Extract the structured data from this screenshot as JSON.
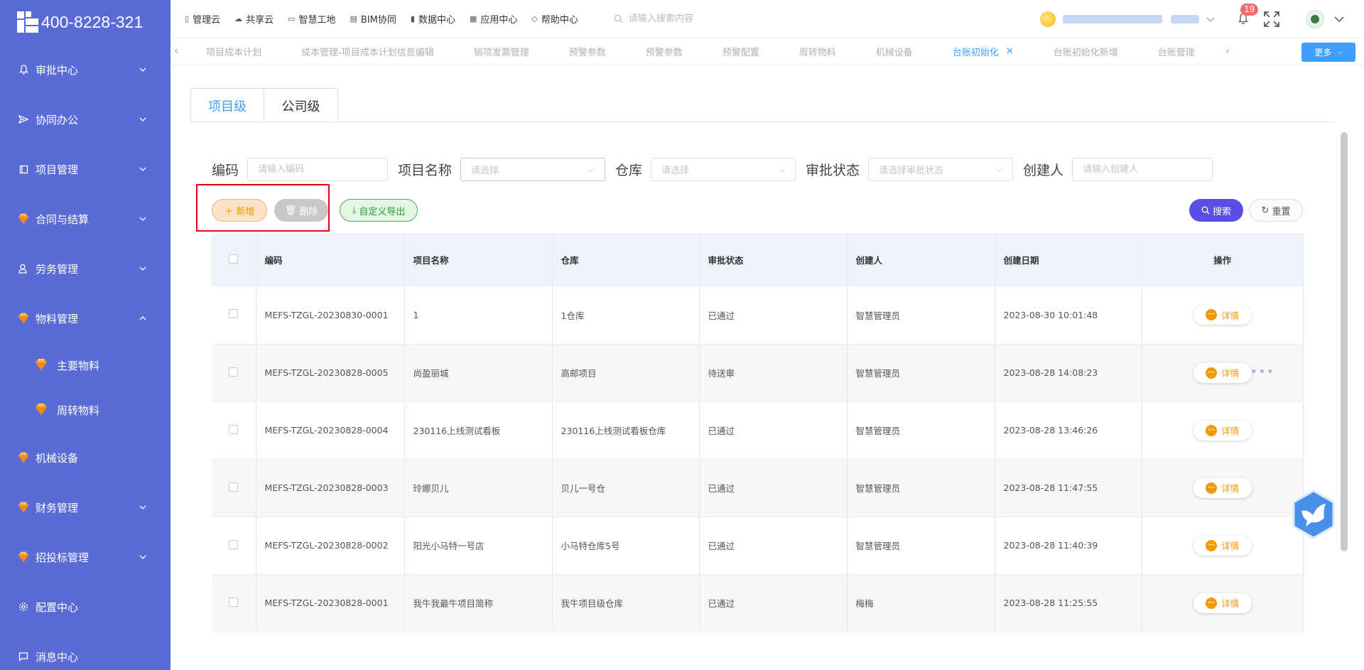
{
  "app": {
    "phone": "400-8228-321"
  },
  "sidebar": {
    "items": [
      {
        "label": "审批中心",
        "icon": "bell-icon"
      },
      {
        "label": "协同办公",
        "icon": "send-icon"
      },
      {
        "label": "项目管理",
        "icon": "book-icon"
      },
      {
        "label": "合同与结算",
        "icon": "gem-icon"
      },
      {
        "label": "劳务管理",
        "icon": "user-icon"
      },
      {
        "label": "物料管理",
        "icon": "gem-icon"
      },
      {
        "label": "机械设备",
        "icon": "gem-icon"
      },
      {
        "label": "财务管理",
        "icon": "gem-icon"
      },
      {
        "label": "招投标管理",
        "icon": "gem-icon"
      },
      {
        "label": "配置中心",
        "icon": "gear-icon"
      },
      {
        "label": "消息中心",
        "icon": "message-icon"
      }
    ],
    "sub_items": [
      {
        "label": "主要物料"
      },
      {
        "label": "周转物料"
      }
    ]
  },
  "topnav": {
    "items": [
      {
        "label": "管理云"
      },
      {
        "label": "共享云"
      },
      {
        "label": "智慧工地"
      },
      {
        "label": "BIM协同"
      },
      {
        "label": "数据中心"
      },
      {
        "label": "应用中心"
      },
      {
        "label": "帮助中心"
      }
    ],
    "search_placeholder": "请输入搜索内容",
    "notification_count": "19"
  },
  "tabs": {
    "items": [
      {
        "label": "项目成本计划"
      },
      {
        "label": "成本管理-项目成本计划信息编辑"
      },
      {
        "label": "销项发票管理"
      },
      {
        "label": "预警参数"
      },
      {
        "label": "预警参数"
      },
      {
        "label": "预警配置"
      },
      {
        "label": "周转物料"
      },
      {
        "label": "机械设备"
      },
      {
        "label": "台账初始化"
      },
      {
        "label": "台账初始化新增"
      },
      {
        "label": "台账管理"
      }
    ],
    "active_index": 8,
    "more_label": "更多"
  },
  "level_tabs": {
    "project": "项目级",
    "company": "公司级"
  },
  "filters": {
    "code_label": "编码",
    "code_placeholder": "请输入编码",
    "project_label": "项目名称",
    "project_placeholder": "请选择",
    "warehouse_label": "仓库",
    "warehouse_placeholder": "请选择",
    "status_label": "审批状态",
    "status_placeholder": "请选择审批状态",
    "creator_label": "创建人",
    "creator_placeholder": "请输入创建人"
  },
  "actions": {
    "add": "新增",
    "delete": "删除",
    "export": "自定义导出",
    "search": "搜索",
    "reset": "重置"
  },
  "table": {
    "columns": [
      "编码",
      "项目名称",
      "仓库",
      "审批状态",
      "创建人",
      "创建日期",
      "操作"
    ],
    "detail_label": "详情",
    "rows": [
      {
        "code": "MEFS-TZGL-20230830-0001",
        "project": "1",
        "warehouse": "1仓库",
        "status": "已通过",
        "creator": "智慧管理员",
        "date": "2023-08-30 10:01:48"
      },
      {
        "code": "MEFS-TZGL-20230828-0005",
        "project": "尚盈丽城",
        "warehouse": "高邮项目",
        "status": "待送审",
        "creator": "智慧管理员",
        "date": "2023-08-28 14:08:23"
      },
      {
        "code": "MEFS-TZGL-20230828-0004",
        "project": "230116上线测试看板",
        "warehouse": "230116上线测试看板仓库",
        "status": "已通过",
        "creator": "智慧管理员",
        "date": "2023-08-28 13:46:26"
      },
      {
        "code": "MEFS-TZGL-20230828-0003",
        "project": "玲娜贝儿",
        "warehouse": "贝儿一号仓",
        "status": "已通过",
        "creator": "智慧管理员",
        "date": "2023-08-28 11:47:55"
      },
      {
        "code": "MEFS-TZGL-20230828-0002",
        "project": "阳光小马特一号店",
        "warehouse": "小马特仓库5号",
        "status": "已通过",
        "creator": "智慧管理员",
        "date": "2023-08-28 11:40:39"
      },
      {
        "code": "MEFS-TZGL-20230828-0001",
        "project": "我牛我最牛项目简称",
        "warehouse": "我牛项目级仓库",
        "status": "已通过",
        "creator": "梅梅",
        "date": "2023-08-28 11:25:55"
      }
    ]
  },
  "colors": {
    "sidebar": "#5b6bd5",
    "primary": "#409eff",
    "accent_orange": "#f39800",
    "search_purple": "#5b4de8"
  }
}
